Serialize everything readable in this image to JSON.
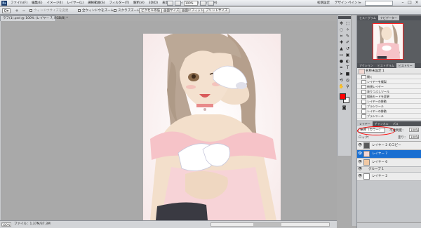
{
  "app": {
    "logo": "Ps"
  },
  "menubar": {
    "items": [
      "ファイル(F)",
      "編集(E)",
      "イメージ(I)",
      "レイヤー(L)",
      "選択範囲(S)",
      "フィルター(T)",
      "解析(A)",
      "3D(D)",
      "表示(V)",
      "ウィンドウ(W)",
      "ヘルプ(H)"
    ],
    "zoom": "100%",
    "workspace_label": "初期設定",
    "workspace_items": [
      "デザイン",
      "ペイント"
    ],
    "expand_label": "»"
  },
  "options": {
    "tool_icon": "Q▾",
    "zoom_in_icon": "+",
    "zoom_out_icon": "−",
    "resize_label": "ウィンドウサイズを変更",
    "all_windows_label": "全ウィンドウをズーム",
    "scrubby_label": "スクラブズーム",
    "actual_pixels": "ピクセル等倍",
    "fit_screen": "画面サイズ",
    "fill_screen": "画面にフィット",
    "print_size": "プリントサイズ"
  },
  "document": {
    "tab_label": "ラフ(1).psd @ 100% (レイヤー 7, RGB/8) *"
  },
  "status": {
    "zoom": "100%",
    "info": "ファイル：1.37M/37.3M"
  },
  "navigator": {
    "tabs": [
      "ナビゲーター",
      "ヒストグラム",
      "情報"
    ]
  },
  "history": {
    "tabs": [
      "アクション",
      "ヒストグラム",
      "ヒストリー"
    ],
    "snapshot": "名称未設定 1",
    "items": [
      "開く",
      "レイヤーを複製",
      "新規レイヤー",
      "塗りつぶしツール",
      "描画モードを変更",
      "レイヤーの移動",
      "ブラシツール",
      "レイヤーの移動",
      "ブラシツール"
    ]
  },
  "layers": {
    "tabs": [
      "レイヤー",
      "チャンネル",
      "パス"
    ],
    "blend_mode": "乗算（カラー）",
    "opacity_label": "不透明度：",
    "opacity": "100%",
    "lock_label": "ロック：",
    "fill_label": "塗り：",
    "fill": "100%",
    "items": [
      {
        "name": "レイヤー 2 のコピー",
        "kind": "layer"
      },
      {
        "name": "レイヤー 7",
        "kind": "layer",
        "selected": true
      },
      {
        "name": "レイヤー 6",
        "kind": "layer"
      },
      {
        "name": "グループ 1",
        "kind": "group"
      },
      {
        "name": "レイヤー 2",
        "kind": "layer"
      }
    ]
  }
}
